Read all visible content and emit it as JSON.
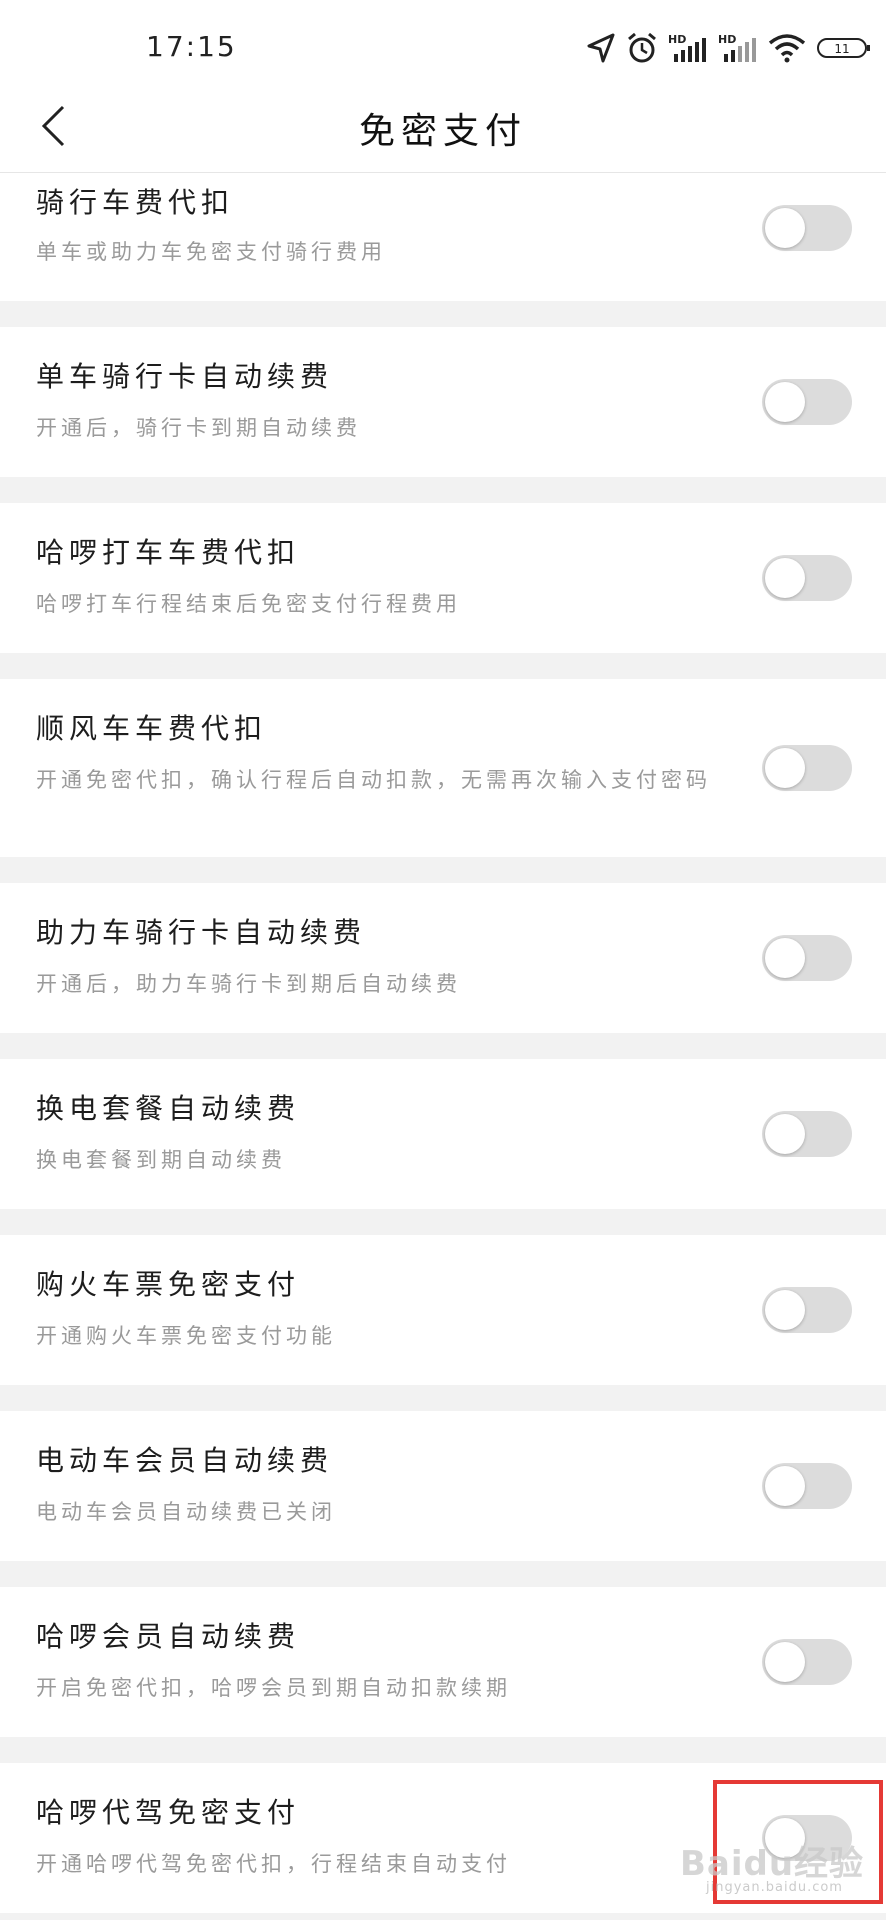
{
  "status_bar": {
    "time": "17:15",
    "icons": [
      "location-arrow-icon",
      "alarm-clock-icon",
      "signal-hd-icon",
      "signal-hd-icon",
      "wifi-icon",
      "battery-icon"
    ],
    "hd_label": "HD",
    "battery_level": "11"
  },
  "nav": {
    "title": "免密支付",
    "back_icon": "chevron-left-icon"
  },
  "settings": [
    {
      "title": "骑行车费代扣",
      "desc": "单车或助力车免密支付骑行费用",
      "enabled": false
    },
    {
      "title": "单车骑行卡自动续费",
      "desc": "开通后，骑行卡到期自动续费",
      "enabled": false
    },
    {
      "title": "哈啰打车车费代扣",
      "desc": "哈啰打车行程结束后免密支付行程费用",
      "enabled": false
    },
    {
      "title": "顺风车车费代扣",
      "desc": "开通免密代扣，确认行程后自动扣款，无需再次输入支付密码",
      "enabled": false
    },
    {
      "title": "助力车骑行卡自动续费",
      "desc": "开通后，助力车骑行卡到期后自动续费",
      "enabled": false
    },
    {
      "title": "换电套餐自动续费",
      "desc": "换电套餐到期自动续费",
      "enabled": false
    },
    {
      "title": "购火车票免密支付",
      "desc": "开通购火车票免密支付功能",
      "enabled": false
    },
    {
      "title": "电动车会员自动续费",
      "desc": "电动车会员自动续费已关闭",
      "enabled": false
    },
    {
      "title": "哈啰会员自动续费",
      "desc": "开启免密代扣，哈啰会员到期自动扣款续期",
      "enabled": false
    },
    {
      "title": "哈啰代驾免密支付",
      "desc": "开通哈啰代驾免密代扣，行程结束自动支付",
      "enabled": false
    }
  ],
  "watermark": {
    "text": "Baidu经验",
    "sub": "jingyan.baidu.com"
  },
  "colors": {
    "highlight": "#e53935",
    "toggle_off": "#dcdcdc",
    "background": "#f2f2f2"
  }
}
